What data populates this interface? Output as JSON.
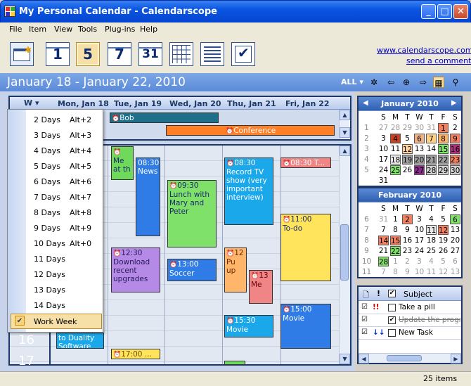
{
  "window": {
    "title": "My Personal Calendar - Calendarscope",
    "minimize": "_",
    "maximize": "□",
    "close": "✕"
  },
  "menu": [
    "File",
    "Item",
    "View",
    "Tools",
    "Plug-ins",
    "Help"
  ],
  "toolbar": {
    "day1": "1",
    "day5": "5",
    "day7": "7",
    "day31": "31",
    "link1": "www.calendarscope.com",
    "link2": "send a comment"
  },
  "datebar": {
    "title": "January 18 - January 22, 2010",
    "filter": "ALL"
  },
  "dayheaders": [
    "Mon, Jan 18",
    "Tue, Jan 19",
    "Wed, Jan 20",
    "Thu, Jan 21",
    "Fri, Jan 22"
  ],
  "viewlabel": "W",
  "allday": [
    {
      "text": "Bob"
    },
    {
      "text": "Conference"
    }
  ],
  "hours": [
    "16",
    "17"
  ],
  "events": [
    {
      "time": "08:30",
      "title": "News"
    },
    {
      "time": "08:30",
      "title": "Record TV show (very important interview)"
    },
    {
      "time": "08:30",
      "title": "T..."
    },
    {
      "time": "09:30",
      "title": "Lunch with Mary and Peter"
    },
    {
      "time": "11:00",
      "title": "To-do"
    },
    {
      "time": "12:30",
      "title": "Download recent upgrades"
    },
    {
      "time": "13:00",
      "title": "Soccer"
    },
    {
      "time": "12",
      "title": "Pu up"
    },
    {
      "time": "13",
      "title": "Me"
    },
    {
      "time": "15:00",
      "title": "Movie"
    },
    {
      "time": "15:30",
      "title": "Movie"
    },
    {
      "time": "17:00",
      "title": "..."
    },
    {
      "time": "",
      "title": "to Duality Software"
    },
    {
      "time": "",
      "title": "Me at th"
    }
  ],
  "dropdown": {
    "items": [
      {
        "label": "2 Days",
        "key": "Alt+2"
      },
      {
        "label": "3 Days",
        "key": "Alt+3"
      },
      {
        "label": "4 Days",
        "key": "Alt+4"
      },
      {
        "label": "5 Days",
        "key": "Alt+5"
      },
      {
        "label": "6 Days",
        "key": "Alt+6"
      },
      {
        "label": "7 Days",
        "key": "Alt+7"
      },
      {
        "label": "8 Days",
        "key": "Alt+8"
      },
      {
        "label": "9 Days",
        "key": "Alt+9"
      },
      {
        "label": "10 Days",
        "key": "Alt+0"
      },
      {
        "label": "11 Days",
        "key": ""
      },
      {
        "label": "12 Days",
        "key": ""
      },
      {
        "label": "13 Days",
        "key": ""
      },
      {
        "label": "14 Days",
        "key": ""
      }
    ],
    "checked": "Work Week"
  },
  "mini1": {
    "title": "January 2010",
    "dow": [
      "S",
      "M",
      "T",
      "W",
      "T",
      "F",
      "S"
    ],
    "weeks": [
      "1",
      "2",
      "3",
      "4",
      "5"
    ],
    "days": [
      [
        "27",
        "28",
        "29",
        "30",
        "31",
        "1",
        "2"
      ],
      [
        "3",
        "4",
        "5",
        "6",
        "7",
        "8",
        "9"
      ],
      [
        "10",
        "11",
        "12",
        "13",
        "14",
        "15",
        "16"
      ],
      [
        "17",
        "18",
        "19",
        "20",
        "21",
        "22",
        "23"
      ],
      [
        "24",
        "25",
        "26",
        "27",
        "28",
        "29",
        "30"
      ],
      [
        "31",
        "",
        "",
        "",
        "",
        "",
        ""
      ]
    ]
  },
  "mini2": {
    "title": "February 2010",
    "dow": [
      "S",
      "M",
      "T",
      "W",
      "T",
      "F",
      "S"
    ],
    "weeks": [
      "6",
      "7",
      "8",
      "9",
      "10",
      "11"
    ],
    "days": [
      [
        "31",
        "1",
        "2",
        "3",
        "4",
        "5",
        "6"
      ],
      [
        "7",
        "8",
        "9",
        "10",
        "11",
        "12",
        "13"
      ],
      [
        "14",
        "15",
        "16",
        "17",
        "18",
        "19",
        "20"
      ],
      [
        "21",
        "22",
        "23",
        "24",
        "25",
        "26",
        "27"
      ],
      [
        "28",
        "1",
        "2",
        "3",
        "4",
        "5",
        "6"
      ],
      [
        "7",
        "8",
        "9",
        "10",
        "11",
        "12",
        "13"
      ]
    ]
  },
  "tasks": {
    "header": {
      "bang": "!",
      "subject": "Subject"
    },
    "rows": [
      {
        "prio": "!!",
        "subject": "Take a pill",
        "done": false
      },
      {
        "prio": "",
        "subject": "Update the progra",
        "done": true
      },
      {
        "prio": "↓↓",
        "subject": "New Task",
        "done": false
      }
    ]
  },
  "status": {
    "count": "25 items"
  }
}
